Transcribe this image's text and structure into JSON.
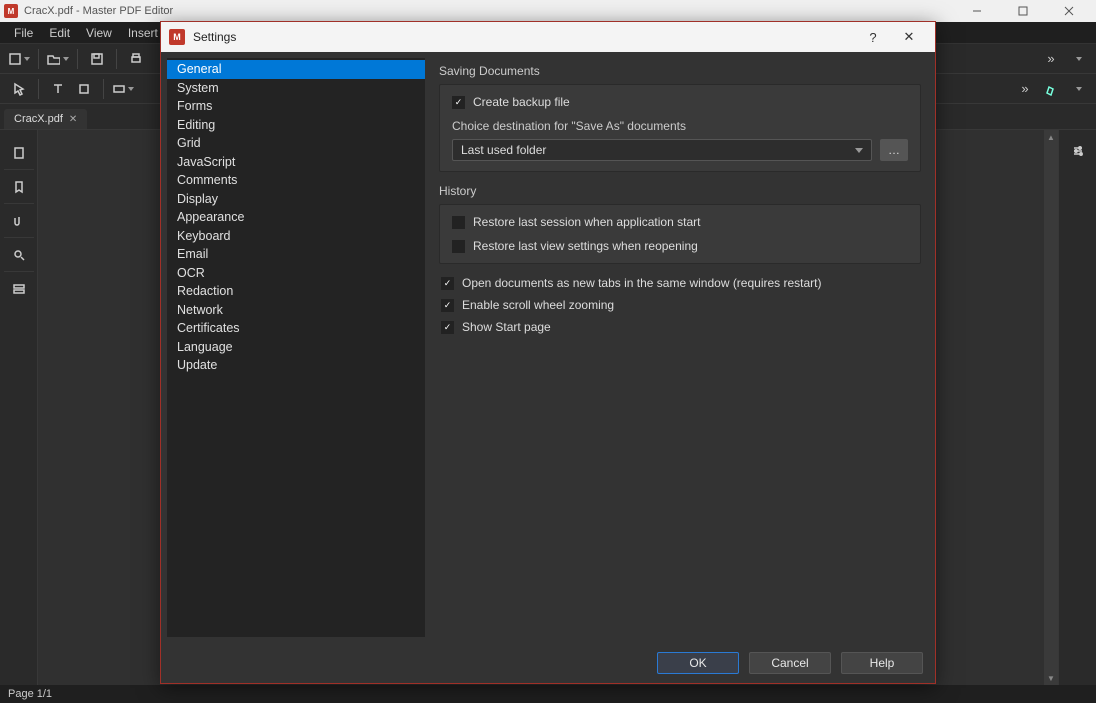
{
  "main_window": {
    "title": "CracX.pdf - Master PDF Editor",
    "menus": [
      "File",
      "Edit",
      "View",
      "Insert"
    ],
    "doc_tab": "CracX.pdf",
    "status": "Page 1/1"
  },
  "dialog": {
    "title": "Settings",
    "help_glyph": "?",
    "close_glyph": "✕",
    "nav": [
      "General",
      "System",
      "Forms",
      "Editing",
      "Grid",
      "JavaScript",
      "Comments",
      "Display",
      "Appearance",
      "Keyboard",
      "Email",
      "OCR",
      "Redaction",
      "Network",
      "Certificates",
      "Language",
      "Update"
    ],
    "nav_selected": "General",
    "section_saving_label": "Saving Documents",
    "saving_create_backup": {
      "checked": true,
      "label": "Create backup file"
    },
    "saving_dest_label": "Choice destination for \"Save As\" documents",
    "saving_dest_value": "Last used folder",
    "section_history_label": "History",
    "history_restore_session": {
      "checked": false,
      "label": "Restore last session when application start"
    },
    "history_restore_view": {
      "checked": false,
      "label": "Restore last view settings when reopening"
    },
    "opt_open_tabs": {
      "checked": true,
      "label": "Open documents as new tabs in the same window (requires restart)"
    },
    "opt_scroll_zoom": {
      "checked": true,
      "label": "Enable scroll wheel zooming"
    },
    "opt_show_start": {
      "checked": true,
      "label": "Show Start page"
    },
    "buttons": {
      "ok": "OK",
      "cancel": "Cancel",
      "help": "Help"
    }
  }
}
